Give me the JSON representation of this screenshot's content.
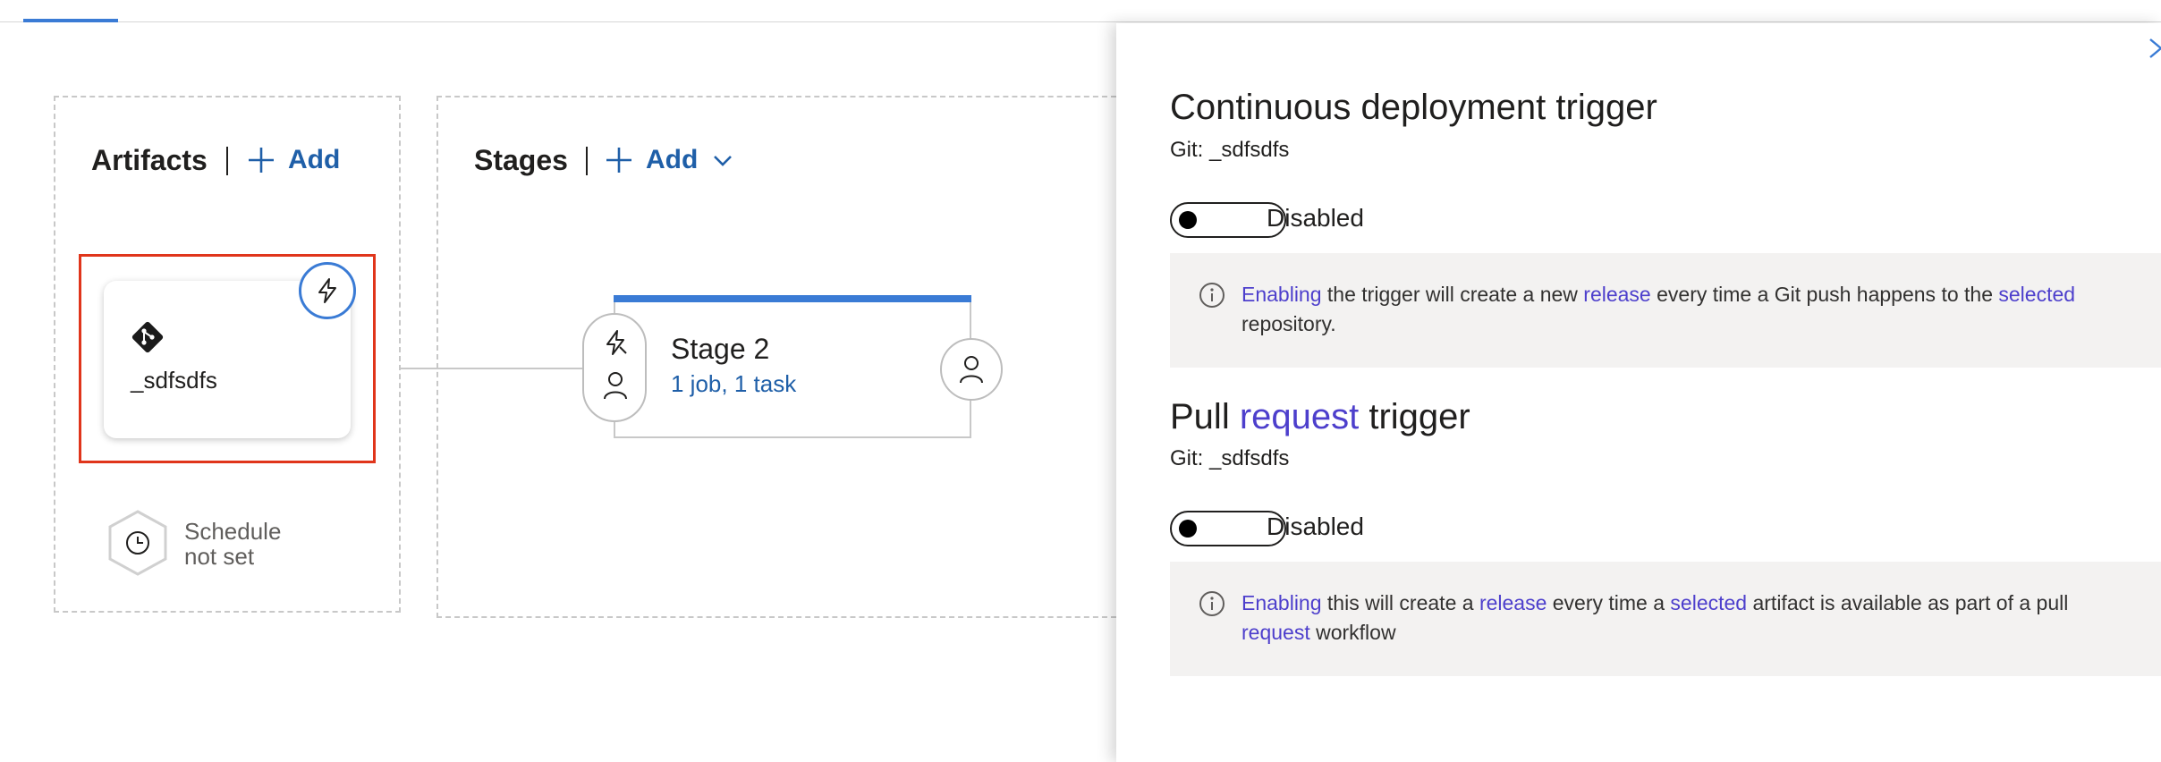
{
  "pipeline": {
    "artifacts": {
      "title": "Artifacts",
      "add_label": "Add",
      "artifact_name": "_sdfsdfs",
      "schedule_line1": "Schedule",
      "schedule_line2": "not set"
    },
    "stages": {
      "title": "Stages",
      "add_label": "Add",
      "stage_name": "Stage 2",
      "stage_tasks": "1 job, 1 task"
    }
  },
  "panel": {
    "cd": {
      "title": "Continuous deployment trigger",
      "source": "Git: _sdfsdfs",
      "toggle_label": "Disabled",
      "enabled": false,
      "info": {
        "w1": "Enabling",
        "t1": " the trigger will create a new ",
        "w2": "release",
        "t2": " every time a Git push happens to the ",
        "w3": "selected",
        "t3": " repository."
      }
    },
    "pr": {
      "title_pre": "Pull ",
      "title_hl": "request",
      "title_post": " trigger",
      "source": "Git: _sdfsdfs",
      "toggle_label": "Disabled",
      "enabled": false,
      "info": {
        "w1": "Enabling",
        "t1": " this will create a ",
        "w2": "release",
        "t2": " every time a ",
        "w3": "selected",
        "t3": " artifact is available as part of a pull ",
        "w4": "request",
        "t4": " workflow"
      }
    }
  },
  "colors": {
    "accent": "#3a7bd5",
    "link": "#1f5fa8",
    "highlight_text": "#4d3fcc",
    "selection_border": "#e0351b",
    "info_background": "#f3f2f1"
  }
}
